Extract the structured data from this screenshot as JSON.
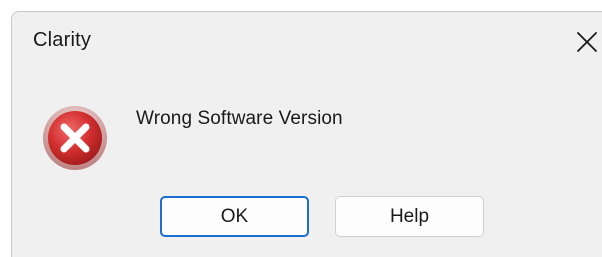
{
  "dialog": {
    "title": "Clarity",
    "message": "Wrong Software Version",
    "icon": "error-icon",
    "close_icon": "close-icon",
    "buttons": {
      "ok_label": "OK",
      "help_label": "Help"
    },
    "colors": {
      "error_red": "#c62828",
      "focus_blue": "#1a6fd0",
      "background": "#f0f0f0"
    }
  }
}
